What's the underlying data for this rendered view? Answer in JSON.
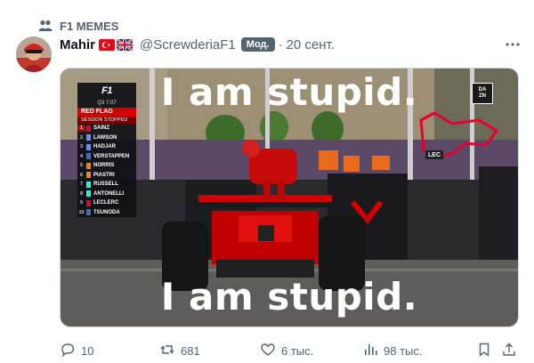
{
  "community": {
    "label": "F1 MEMES",
    "icon": "community-icon"
  },
  "post": {
    "author_name": "Mahir",
    "flags": [
      "turkey-flag",
      "uk-flag"
    ],
    "handle": "@ScrewderiaF1",
    "badge": "Мод.",
    "separator": "·",
    "time": "20 сент."
  },
  "media": {
    "caption_top": "I am stupid.",
    "caption_bottom": "I am stupid.",
    "broadcaster_line1": "DA",
    "broadcaster_line2": "ZN",
    "track_label": "LEC",
    "timing": {
      "logo": "F1",
      "session": "Q3 7:07",
      "flag": "RED FLAG",
      "status": "SESSION STOPPED",
      "rows": [
        {
          "pos": "1",
          "driver": "SAINZ",
          "color": "#e8002d"
        },
        {
          "pos": "2",
          "driver": "LAWSON",
          "color": "#6692ff"
        },
        {
          "pos": "3",
          "driver": "HADJAR",
          "color": "#6692ff"
        },
        {
          "pos": "4",
          "driver": "VERSTAPPEN",
          "color": "#3671c6"
        },
        {
          "pos": "5",
          "driver": "NORRIS",
          "color": "#ff8000"
        },
        {
          "pos": "6",
          "driver": "PIASTRI",
          "color": "#ff8000"
        },
        {
          "pos": "7",
          "driver": "RUSSELL",
          "color": "#27f4d2"
        },
        {
          "pos": "8",
          "driver": "ANTONELLI",
          "color": "#27f4d2"
        },
        {
          "pos": "9",
          "driver": "LECLERC",
          "color": "#e8002d"
        },
        {
          "pos": "10",
          "driver": "TSUNODA",
          "color": "#3671c6"
        }
      ]
    }
  },
  "actions": {
    "replies": "10",
    "reposts": "681",
    "likes": "6 тыс.",
    "views": "98 тыс."
  },
  "colors": {
    "text_secondary": "#536471",
    "ferrari_red": "#d40000"
  }
}
